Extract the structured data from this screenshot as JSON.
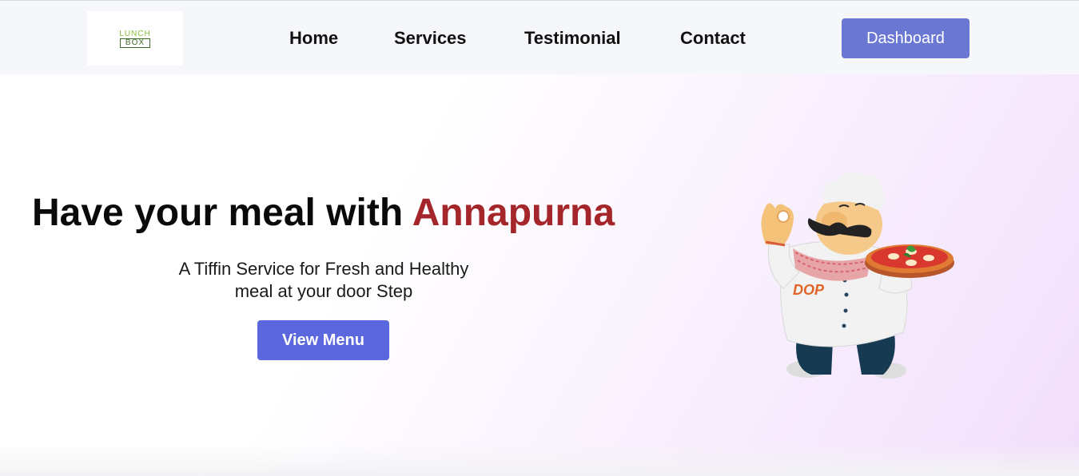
{
  "header": {
    "logo": {
      "line1": "LUNCH",
      "line2": "BOX"
    },
    "nav": [
      {
        "label": "Home"
      },
      {
        "label": "Services"
      },
      {
        "label": "Testimonial"
      },
      {
        "label": "Contact"
      }
    ],
    "dashboard_label": "Dashboard"
  },
  "hero": {
    "title_prefix": "Have your meal with ",
    "brand_name": "Annapurna",
    "subtitle_line1": "A Tiffin Service for Fresh and Healthy",
    "subtitle_line2": "meal at your door Step",
    "cta_label": "View Menu",
    "illustration_icon": "chef-with-pizza-icon",
    "apron_text": "DOP"
  },
  "colors": {
    "brand_red": "#a4262b",
    "dashboard_button": "#6b78d3",
    "cta_button": "#5b68dd",
    "logo_green": "#8bbf3a"
  }
}
